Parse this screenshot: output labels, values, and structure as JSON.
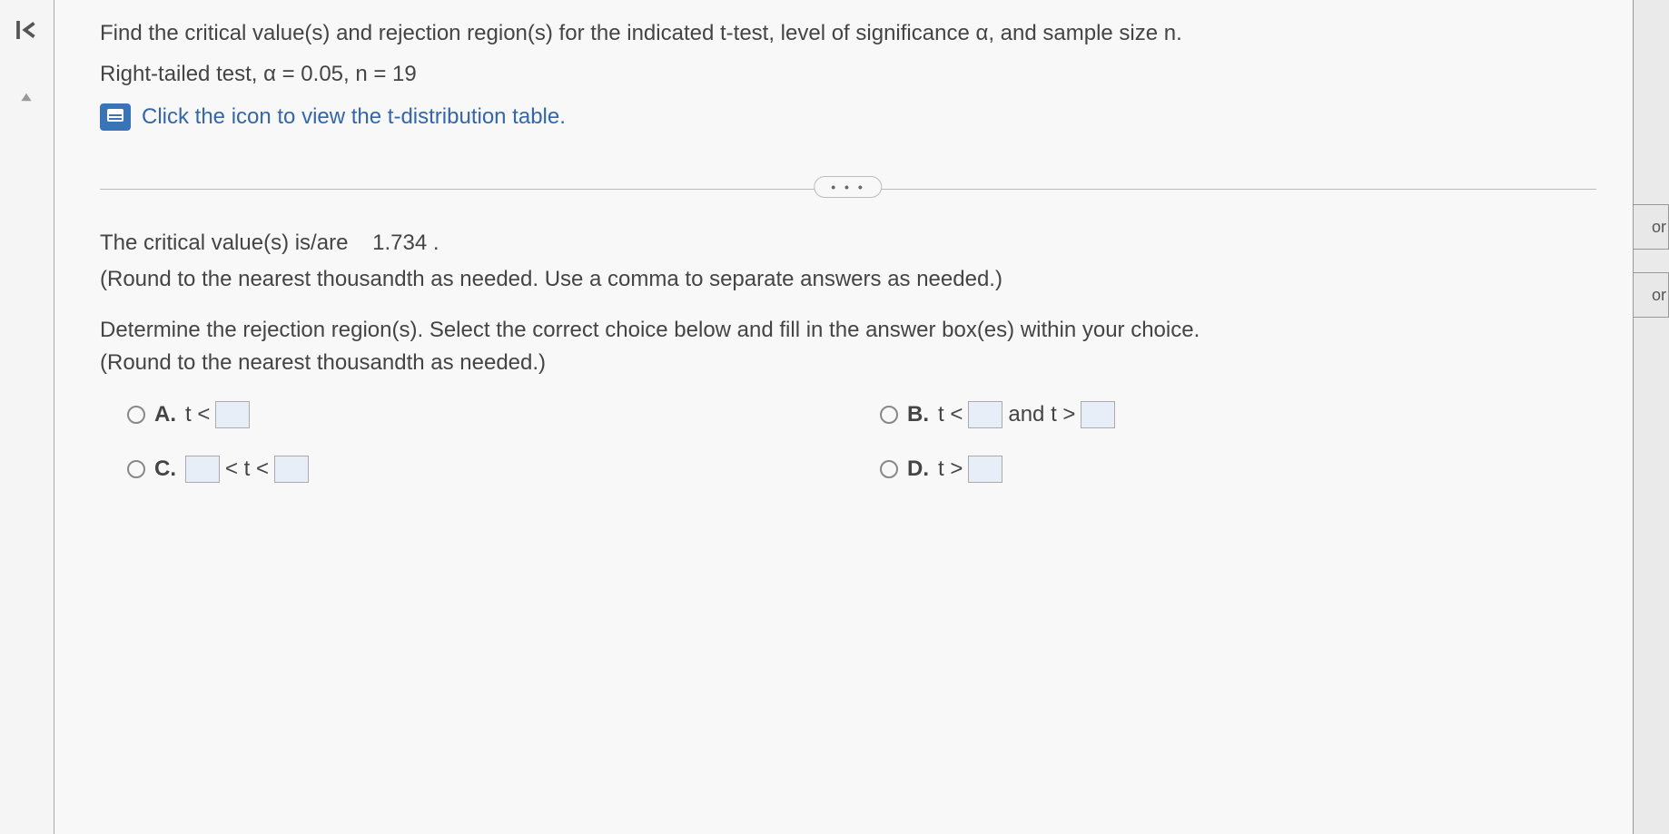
{
  "question": {
    "line1": "Find the critical value(s) and rejection region(s) for the indicated t-test, level of significance α, and sample size n.",
    "line2": "Right-tailed test, α = 0.05, n = 19",
    "tableLink": "Click the icon to view the t-distribution table."
  },
  "criticalValue": {
    "prefix": "The critical value(s) is/are",
    "value": "1.734",
    "suffix": "."
  },
  "instruction1": "(Round to the nearest thousandth as needed. Use a comma to separate answers as needed.)",
  "instruction2": "Determine the rejection region(s). Select the correct choice below and fill in the answer box(es) within your choice.",
  "instruction3": "(Round to the nearest thousandth as needed.)",
  "choices": {
    "a": {
      "label": "A.",
      "text1": "t <"
    },
    "b": {
      "label": "B.",
      "text1": "t <",
      "text2": "and t >"
    },
    "c": {
      "label": "C.",
      "text2": "< t <"
    },
    "d": {
      "label": "D.",
      "text1": "t >"
    }
  },
  "ellipsis": "• • •",
  "rightLabels": {
    "cell1": "or",
    "cell2": "or"
  }
}
